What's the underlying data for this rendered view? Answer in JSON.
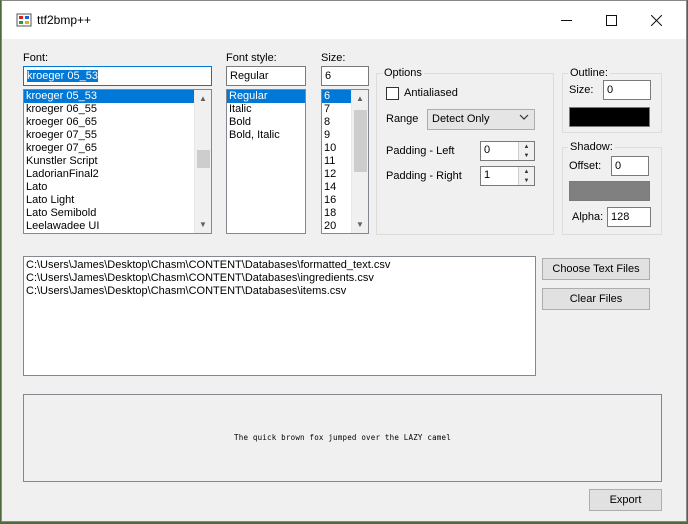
{
  "window": {
    "title": "ttf2bmp++",
    "controls": {
      "minimize": "—",
      "maximize": "☐",
      "close": "✕"
    }
  },
  "font": {
    "label": "Font:",
    "value": "kroeger 05_53",
    "items": [
      "kroeger 05_53",
      "kroeger 06_55",
      "kroeger 06_65",
      "kroeger 07_55",
      "kroeger 07_65",
      "Kunstler Script",
      "LadorianFinal2",
      "Lato",
      "Lato Light",
      "Lato Semibold",
      "Leelawadee UI"
    ],
    "selected_index": 0
  },
  "font_style": {
    "label": "Font style:",
    "value": "Regular",
    "items": [
      "Regular",
      "Italic",
      "Bold",
      "Bold, Italic"
    ],
    "selected_index": 0
  },
  "size": {
    "label": "Size:",
    "value": "6",
    "items": [
      "6",
      "7",
      "8",
      "9",
      "10",
      "11",
      "12",
      "14",
      "16",
      "18",
      "20"
    ],
    "selected_index": 0
  },
  "options": {
    "title": "Options",
    "antialiased_label": "Antialiased",
    "antialiased_checked": false,
    "range_label": "Range",
    "range_value": "Detect Only",
    "padding_left_label": "Padding - Left",
    "padding_left_value": "0",
    "padding_right_label": "Padding - Right",
    "padding_right_value": "1"
  },
  "outline": {
    "title": "Outline:",
    "size_label": "Size:",
    "size_value": "0",
    "color": "#000000"
  },
  "shadow": {
    "title": "Shadow:",
    "offset_label": "Offset:",
    "offset_value": "0",
    "color": "#808080",
    "alpha_label": "Alpha:",
    "alpha_value": "128"
  },
  "files": {
    "items": [
      "C:\\Users\\James\\Desktop\\Chasm\\CONTENT\\Databases\\formatted_text.csv",
      "C:\\Users\\James\\Desktop\\Chasm\\CONTENT\\Databases\\ingredients.csv",
      "C:\\Users\\James\\Desktop\\Chasm\\CONTENT\\Databases\\items.csv"
    ],
    "choose_label": "Choose Text Files",
    "clear_label": "Clear Files"
  },
  "preview": {
    "text": "The quick brown fox jumped over the LAZY camel"
  },
  "export_label": "Export",
  "icons": {
    "app": "ttf2bmp-app-icon",
    "scroll_up": "chevron-up-icon",
    "scroll_down": "chevron-down-icon",
    "combo": "chevron-down-icon"
  }
}
